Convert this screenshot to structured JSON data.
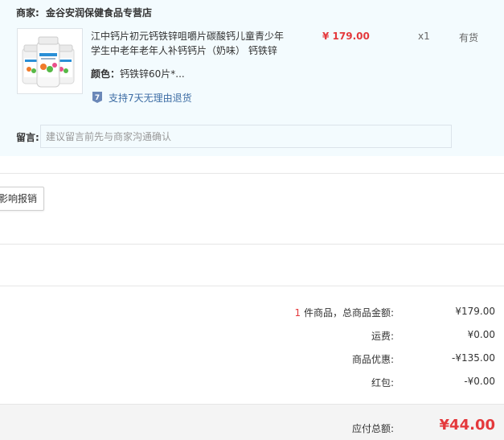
{
  "shop": {
    "label": "商家:",
    "name": "金谷安润保健食品专营店"
  },
  "product": {
    "title": "江中钙片初元钙铁锌咀嚼片碳酸钙儿童青少年学生中老年老年人补钙钙片（奶味） 钙铁锌",
    "price": "¥ 179.00",
    "quantity": "x1",
    "stock": "有货",
    "spec_label": "颜色：",
    "spec_value": "钙铁锌60片*...",
    "return_badge": "7",
    "return_policy": "支持7天无理由退货"
  },
  "memo": {
    "label": "留言:",
    "placeholder": "建议留言前先与商家沟通确认",
    "value": ""
  },
  "invoice": {
    "button_label": "影响报销"
  },
  "summary": {
    "count": "1",
    "count_suffix": " 件商品，总商品金额:",
    "goods_total": "¥179.00",
    "shipping_label": "运费:",
    "shipping": "¥0.00",
    "discount_label": "商品优惠:",
    "discount": "-¥135.00",
    "redpacket_label": "红包:",
    "redpacket": "-¥0.00"
  },
  "total": {
    "label": "应付总额:",
    "value": "¥44.00"
  },
  "colors": {
    "accent_red": "#e4393c",
    "link_blue": "#3e6ea5",
    "panel_bg": "#f3fbfe"
  }
}
